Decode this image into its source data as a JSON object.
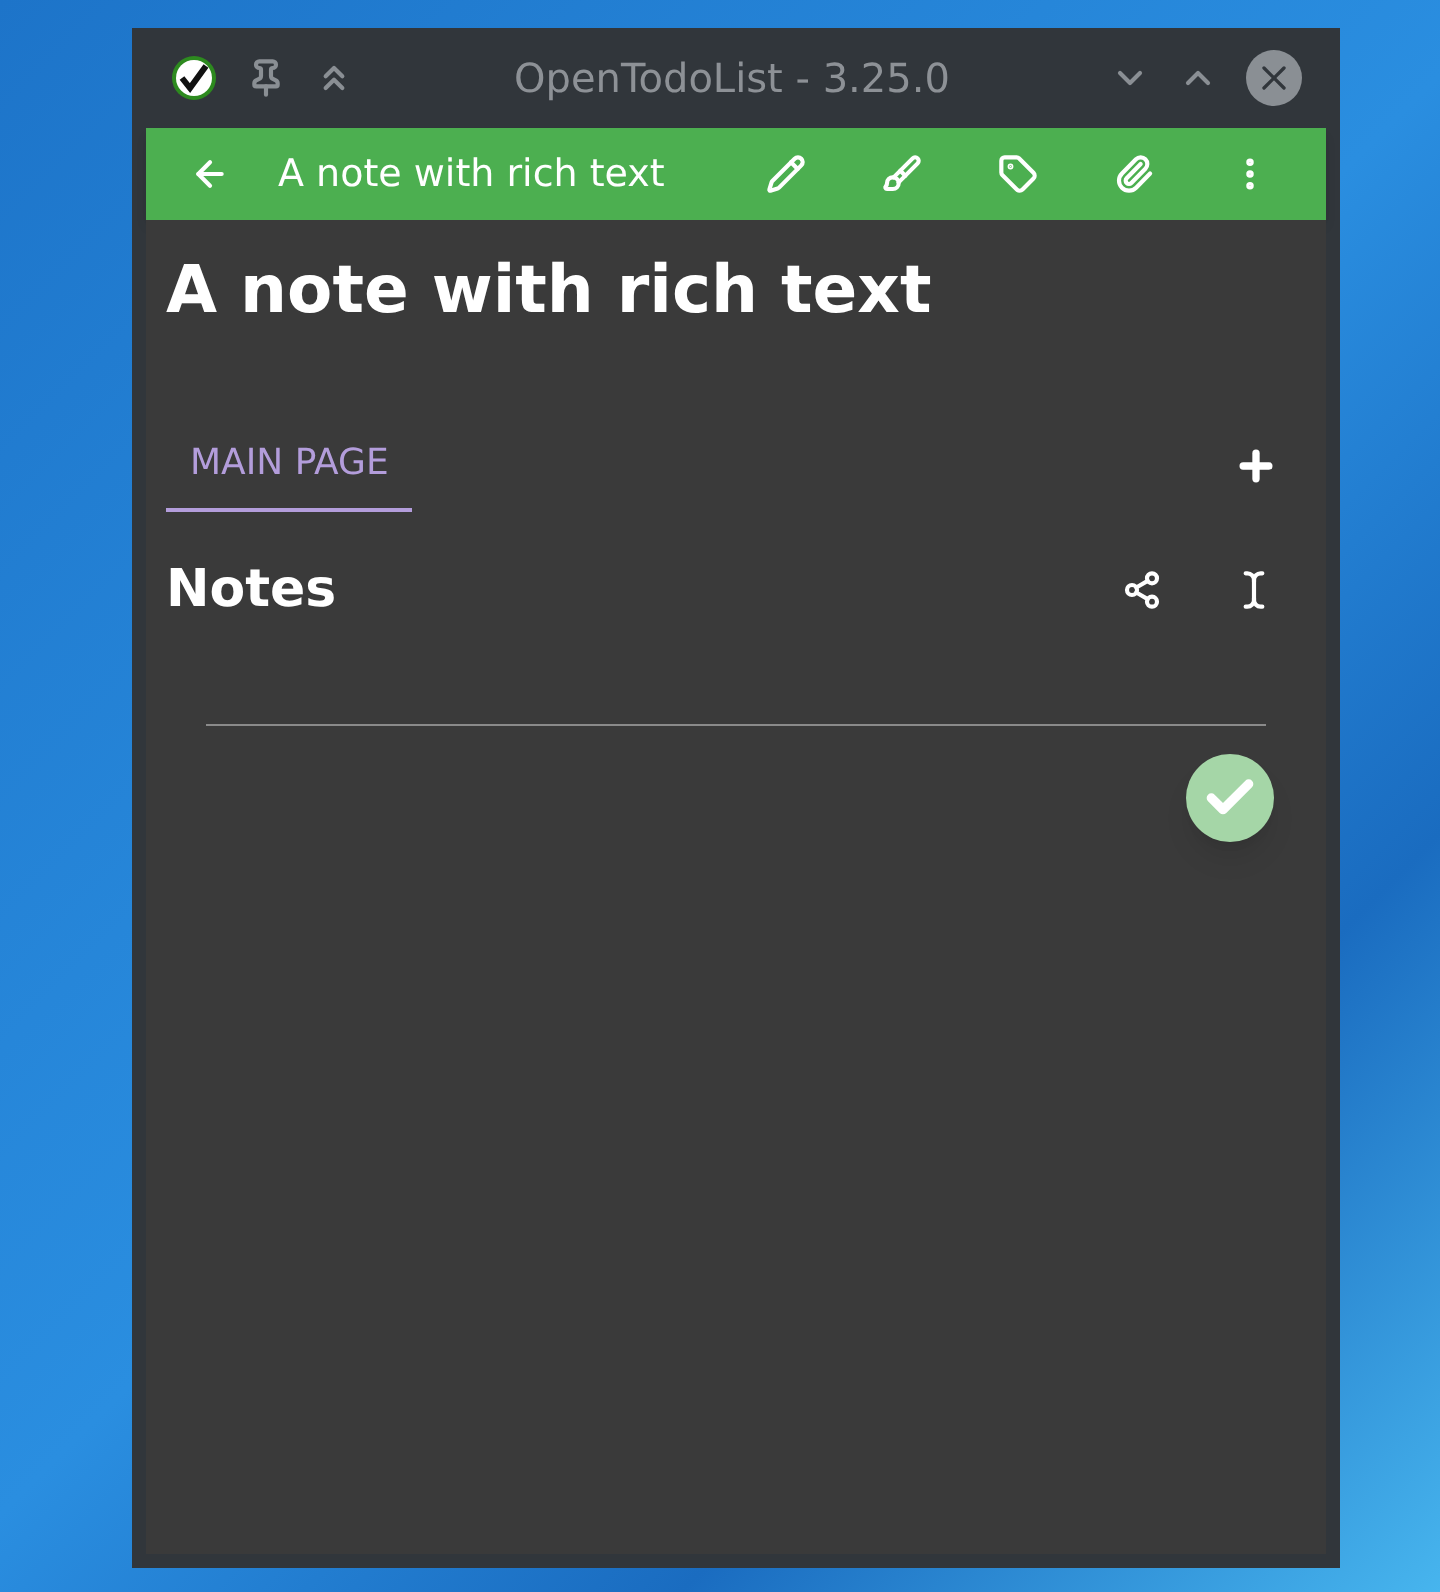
{
  "window": {
    "title": "OpenTodoList - 3.25.0"
  },
  "toolbar": {
    "title": "A note with rich text"
  },
  "note": {
    "title": "A note with rich text"
  },
  "tabs": [
    {
      "label": "MAIN PAGE",
      "selected": true
    }
  ],
  "section": {
    "title": "Notes"
  }
}
